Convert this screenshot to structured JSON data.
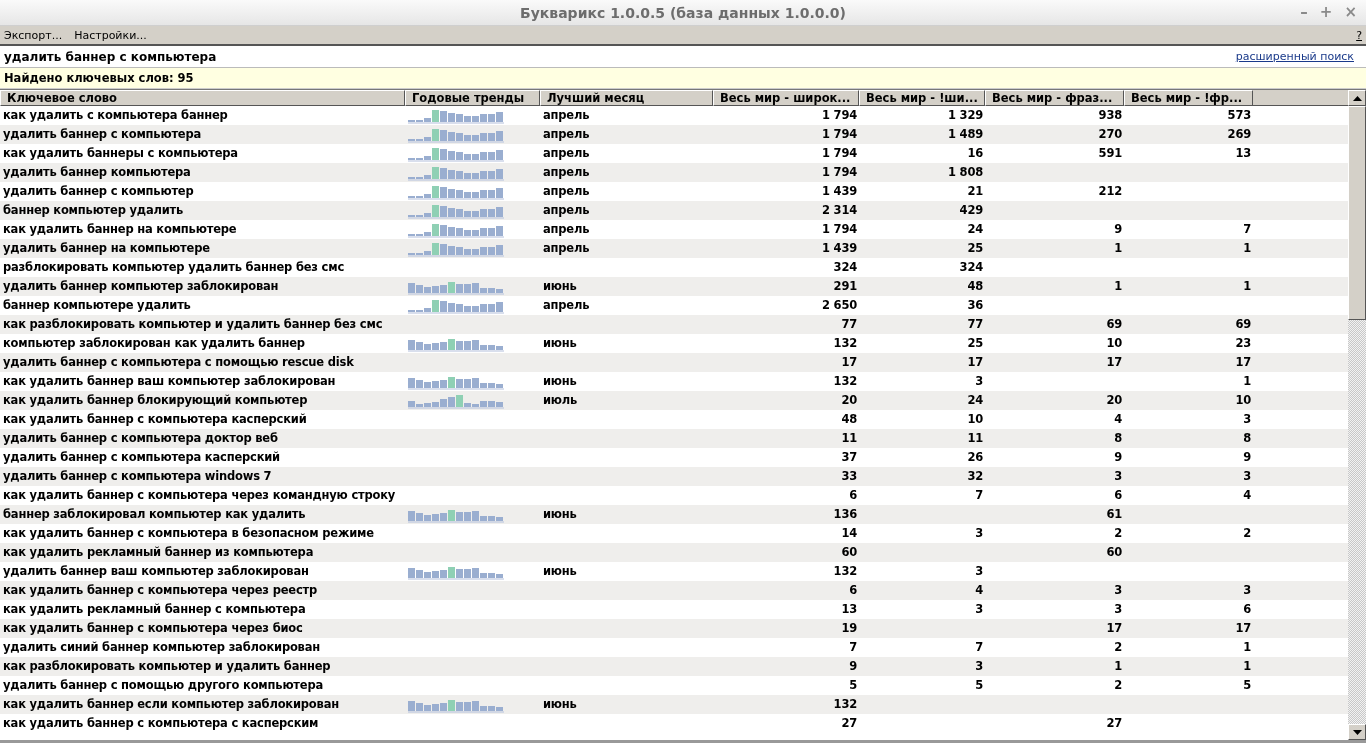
{
  "window": {
    "title": "Букварикс 1.0.0.5 (база данных 1.0.0.0)",
    "controls": [
      "–",
      "+",
      "×"
    ]
  },
  "menu": [
    {
      "label": "Экспорт..."
    },
    {
      "label": "Настройки..."
    }
  ],
  "help": "?",
  "search": {
    "value": "удалить баннер с компьютера",
    "advanced_link": "расширенный поиск"
  },
  "status": "Найдено ключевых слов: 95",
  "table": {
    "columns": [
      "Ключевое слово",
      "Годовые тренды",
      "Лучший месяц",
      "Весь мир - широк...",
      "Весь мир - !ши...",
      "Весь мир - фраз...",
      "Весь мир - !фр..."
    ],
    "rows": [
      {
        "keyword": "как удалить с компьютера баннер",
        "kind": "april",
        "month": "апрель",
        "counts": {
          "c1": "1 794",
          "c2": "1 329",
          "c3": "938",
          "c4": "573"
        }
      },
      {
        "keyword": "удалить баннер с компьютера",
        "kind": "april",
        "month": "апрель",
        "counts": {
          "c1": "1 794",
          "c2": "1 489",
          "c3": "270",
          "c4": "269"
        }
      },
      {
        "keyword": "как удалить баннеры с компьютера",
        "kind": "april",
        "month": "апрель",
        "counts": {
          "c1": "1 794",
          "c2": "16",
          "c3": "591",
          "c4": "13"
        }
      },
      {
        "keyword": "удалить баннер компьютера",
        "kind": "april",
        "month": "апрель",
        "counts": {
          "c1": "1 794",
          "c2": "1 808"
        }
      },
      {
        "keyword": "удалить баннер с компьютер",
        "kind": "april",
        "month": "апрель",
        "counts": {
          "c1": "1 439",
          "c2": "21",
          "c3": "212"
        }
      },
      {
        "keyword": "баннер компьютер удалить",
        "kind": "april",
        "month": "апрель",
        "counts": {
          "c1": "2 314",
          "c2": "429"
        }
      },
      {
        "keyword": "как удалить баннер на компьютере",
        "kind": "april",
        "month": "апрель",
        "counts": {
          "c1": "1 794",
          "c2": "24",
          "c3": "9",
          "c4": "7"
        }
      },
      {
        "keyword": "удалить баннер на компьютере",
        "kind": "april",
        "month": "апрель",
        "counts": {
          "c1": "1 439",
          "c2": "25",
          "c3": "1",
          "c4": "1"
        }
      },
      {
        "keyword": "разблокировать компьютер удалить баннер без смс",
        "counts": {
          "c1": "324",
          "c2": "324"
        }
      },
      {
        "keyword": "удалить баннер компьютер заблокирован",
        "kind": "june",
        "month": "июнь",
        "counts": {
          "c1": "291",
          "c2": "48",
          "c3": "1",
          "c4": "1"
        }
      },
      {
        "keyword": "баннер компьютере удалить",
        "kind": "april",
        "month": "апрель",
        "counts": {
          "c1": "2 650",
          "c2": "36"
        }
      },
      {
        "keyword": "как разблокировать компьютер и удалить баннер без смс",
        "counts": {
          "c1": "77",
          "c2": "77",
          "c3": "69",
          "c4": "69"
        }
      },
      {
        "keyword": "компьютер заблокирован как удалить баннер",
        "kind": "june",
        "month": "июнь",
        "counts": {
          "c1": "132",
          "c2": "25",
          "c3": "10",
          "c4": "23"
        }
      },
      {
        "keyword": "удалить баннер с компьютера с помощью rescue disk",
        "counts": {
          "c1": "17",
          "c2": "17",
          "c3": "17",
          "c4": "17"
        }
      },
      {
        "keyword": "как удалить баннер ваш компьютер заблокирован",
        "kind": "june",
        "month": "июнь",
        "counts": {
          "c1": "132",
          "c2": "3",
          "c4": "1"
        }
      },
      {
        "keyword": "как удалить баннер блокирующий компьютер",
        "kind": "july",
        "month": "июль",
        "counts": {
          "c1": "20",
          "c2": "24",
          "c3": "20",
          "c4": "10"
        }
      },
      {
        "keyword": "как удалить баннер с компьютера касперский",
        "counts": {
          "c1": "48",
          "c2": "10",
          "c3": "4",
          "c4": "3"
        }
      },
      {
        "keyword": "удалить баннер с компьютера доктор веб",
        "counts": {
          "c1": "11",
          "c2": "11",
          "c3": "8",
          "c4": "8"
        }
      },
      {
        "keyword": "удалить баннер с компьютера касперский",
        "counts": {
          "c1": "37",
          "c2": "26",
          "c3": "9",
          "c4": "9"
        }
      },
      {
        "keyword": "удалить баннер с компьютера windows 7",
        "counts": {
          "c1": "33",
          "c2": "32",
          "c3": "3",
          "c4": "3"
        }
      },
      {
        "keyword": "как удалить баннер с компьютера через командную строку",
        "counts": {
          "c1": "6",
          "c2": "7",
          "c3": "6",
          "c4": "4"
        }
      },
      {
        "keyword": "баннер заблокировал компьютер как удалить",
        "kind": "june",
        "month": "июнь",
        "counts": {
          "c1": "136",
          "c3": "61"
        }
      },
      {
        "keyword": "как удалить баннер с компьютера в безопасном режиме",
        "counts": {
          "c1": "14",
          "c2": "3",
          "c3": "2",
          "c4": "2"
        }
      },
      {
        "keyword": "как удалить рекламный баннер из компьютера",
        "counts": {
          "c1": "60",
          "c3": "60"
        }
      },
      {
        "keyword": "удалить баннер ваш компьютер заблокирован",
        "kind": "june",
        "month": "июнь",
        "counts": {
          "c1": "132",
          "c2": "3"
        }
      },
      {
        "keyword": "как удалить баннер с компьютера через реестр",
        "counts": {
          "c1": "6",
          "c2": "4",
          "c3": "3",
          "c4": "3"
        }
      },
      {
        "keyword": "как удалить рекламный баннер с компьютера",
        "counts": {
          "c1": "13",
          "c2": "3",
          "c3": "3",
          "c4": "6"
        }
      },
      {
        "keyword": "как удалить баннер с компьютера через биос",
        "counts": {
          "c1": "19",
          "c3": "17",
          "c4": "17"
        }
      },
      {
        "keyword": "удалить синий баннер компьютер заблокирован",
        "counts": {
          "c1": "7",
          "c2": "7",
          "c3": "2",
          "c4": "1"
        }
      },
      {
        "keyword": "как разблокировать компьютер и удалить баннер",
        "counts": {
          "c1": "9",
          "c2": "3",
          "c3": "1",
          "c4": "1"
        }
      },
      {
        "keyword": "удалить баннер с помощью другого компьютера",
        "counts": {
          "c1": "5",
          "c2": "5",
          "c3": "2",
          "c4": "5"
        }
      },
      {
        "keyword": "как удалить баннер если компьютер заблокирован",
        "kind": "june",
        "month": "июнь",
        "counts": {
          "c1": "132"
        }
      },
      {
        "keyword": "как удалить баннер с компьютера с касперским",
        "counts": {
          "c1": "27",
          "c3": "27"
        }
      }
    ]
  }
}
